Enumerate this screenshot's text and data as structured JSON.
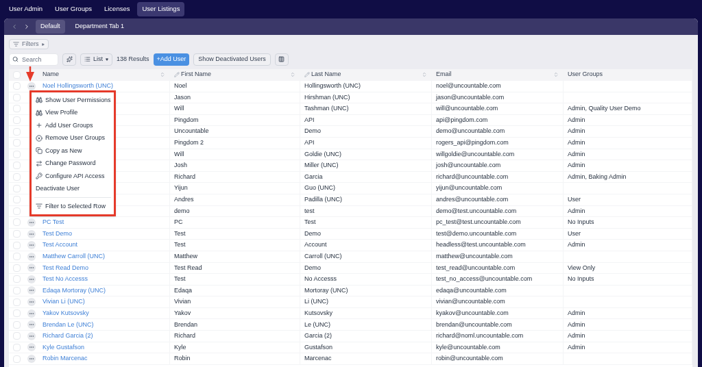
{
  "nav_tabs": [
    {
      "label": "User Admin",
      "selected": false
    },
    {
      "label": "User Groups",
      "selected": false
    },
    {
      "label": "Licenses",
      "selected": false
    },
    {
      "label": "User Listings",
      "selected": true
    }
  ],
  "sub_tabs": [
    {
      "label": "Default",
      "selected": true
    },
    {
      "label": "Department Tab 1",
      "selected": false
    }
  ],
  "toolbar": {
    "filters": "Filters",
    "search": {
      "placeholder": "Search"
    },
    "view": "List",
    "results": "138 Results",
    "add_button": "+Add User",
    "deactivated_button": "Show Deactivated Users"
  },
  "table": {
    "columns": [
      {
        "label": "Name",
        "editable": false,
        "sortable": true
      },
      {
        "label": "First Name",
        "editable": true,
        "sortable": true
      },
      {
        "label": "Last Name",
        "editable": true,
        "sortable": true
      },
      {
        "label": "Email",
        "editable": false,
        "sortable": true
      },
      {
        "label": "User Groups",
        "editable": false,
        "sortable": false
      }
    ],
    "select_all_checked": false,
    "rows": [
      {
        "checked": false,
        "name": "Noel Hollingsworth (UNC)",
        "first_name": "Noel",
        "last_name": "Hollingsworth (UNC)",
        "email": "noel@uncountable.com"
      },
      {
        "checked": false,
        "first_name": "Jason",
        "last_name": "Hirshman (UNC)",
        "email": "jason@uncountable.com"
      },
      {
        "checked": false,
        "first_name": "Will",
        "last_name": "Tashman (UNC)",
        "email": "will@uncountable.com",
        "user_groups": "Admin, Quality User Demo"
      },
      {
        "checked": false,
        "first_name": "Pingdom",
        "last_name": "API",
        "email": "api@pingdom.com",
        "user_groups": "Admin"
      },
      {
        "checked": false,
        "first_name": "Uncountable",
        "last_name": "Demo",
        "email": "demo@uncountable.com",
        "user_groups": "Admin"
      },
      {
        "checked": false,
        "first_name": "Pingdom 2",
        "last_name": "API",
        "email": "rogers_api@pingdom.com",
        "user_groups": "Admin"
      },
      {
        "checked": false,
        "first_name": "Will",
        "last_name": "Goldie (UNC)",
        "email": "willgoldie@uncountable.com",
        "user_groups": "Admin"
      },
      {
        "checked": false,
        "first_name": "Josh",
        "last_name": "Miller (UNC)",
        "email": "josh@uncountable.com",
        "user_groups": "Admin"
      },
      {
        "checked": false,
        "first_name": "Richard",
        "last_name": "Garcia",
        "email": "richard@uncountable.com",
        "user_groups": "Admin, Baking Admin"
      },
      {
        "checked": false,
        "first_name": "Yijun",
        "last_name": "Guo (UNC)",
        "email": "yijun@uncountable.com"
      },
      {
        "checked": false,
        "first_name": "Andres",
        "last_name": "Padilla (UNC)",
        "email": "andres@uncountable.com",
        "user_groups": "User"
      },
      {
        "checked": false,
        "first_name": "demo",
        "last_name": "test",
        "email": "demo@test.uncountable.com",
        "user_groups": "Admin"
      },
      {
        "checked": false,
        "name": "PC Test",
        "first_name": "PC",
        "last_name": "Test",
        "email": "pc_test@test.uncountable.com",
        "user_groups": "No Inputs"
      },
      {
        "checked": false,
        "name": "Test Demo",
        "first_name": "Test",
        "last_name": "Demo",
        "email": "test@demo.uncountable.com",
        "user_groups": "User"
      },
      {
        "checked": false,
        "name": "Test Account",
        "first_name": "Test",
        "last_name": "Account",
        "email": "headless@test.uncountable.com",
        "user_groups": "Admin"
      },
      {
        "checked": false,
        "name": "Matthew Carroll (UNC)",
        "first_name": "Matthew",
        "last_name": "Carroll (UNC)",
        "email": "matthew@uncountable.com"
      },
      {
        "checked": false,
        "name": "Test Read Demo",
        "first_name": "Test Read",
        "last_name": "Demo",
        "email": "test_read@uncountable.com",
        "user_groups": "View Only"
      },
      {
        "checked": false,
        "name": "Test No Accesss",
        "first_name": "Test",
        "last_name": "No Accesss",
        "email": "test_no_access@uncountable.com",
        "user_groups": "No Inputs"
      },
      {
        "checked": false,
        "name": "Edaqa Mortoray (UNC)",
        "first_name": "Edaqa",
        "last_name": "Mortoray (UNC)",
        "email": "edaqa@uncountable.com"
      },
      {
        "checked": false,
        "name": "Vivian Li (UNC)",
        "first_name": "Vivian",
        "last_name": "Li (UNC)",
        "email": "vivian@uncountable.com"
      },
      {
        "checked": false,
        "name": "Yakov Kutsovsky",
        "first_name": "Yakov",
        "last_name": "Kutsovsky",
        "email": "kyakov@uncountable.com",
        "user_groups": "Admin"
      },
      {
        "checked": false,
        "name": "Brendan Le (UNC)",
        "first_name": "Brendan",
        "last_name": "Le (UNC)",
        "email": "brendan@uncountable.com",
        "user_groups": "Admin"
      },
      {
        "checked": false,
        "name": "Richard Garcia (2)",
        "first_name": "Richard",
        "last_name": "Garcia (2)",
        "email": "richard@noml.uncountable.com",
        "user_groups": "Admin"
      },
      {
        "checked": false,
        "name": "Kyle Gustafson",
        "first_name": "Kyle",
        "last_name": "Gustafson",
        "email": "kyle@uncountable.com",
        "user_groups": "Admin"
      },
      {
        "checked": false,
        "name": "Robin Marcenac",
        "first_name": "Robin",
        "last_name": "Marcenac",
        "email": "robin@uncountable.com"
      }
    ]
  },
  "context_menu": {
    "items": [
      {
        "label": "Show User Permissions",
        "kind": "binoculars"
      },
      {
        "label": "View Profile",
        "kind": "binoculars"
      },
      {
        "label": "Add User Groups",
        "kind": "plus"
      },
      {
        "label": "Remove User Groups",
        "kind": "x-circle"
      },
      {
        "label": "Copy as New",
        "kind": "copy"
      },
      {
        "label": "Change Password",
        "kind": "swap"
      },
      {
        "label": "Configure API Access",
        "kind": "key"
      },
      {
        "label": "Deactivate User",
        "kind": "plain"
      },
      {
        "label": "Filter to Selected Row",
        "kind": "filter",
        "separated": true
      }
    ]
  }
}
